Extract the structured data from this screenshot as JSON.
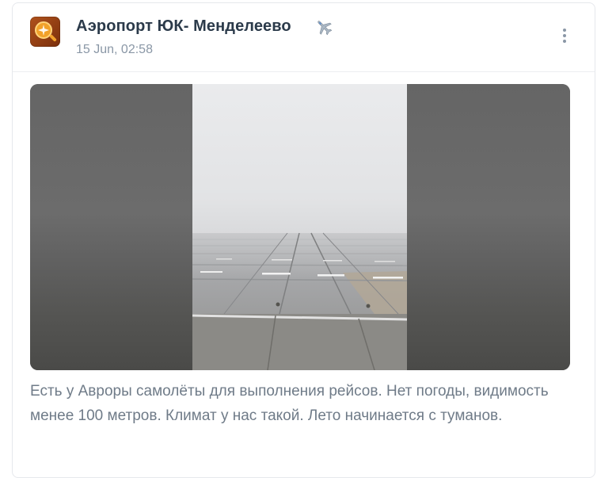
{
  "post": {
    "channel_name": "Аэропорт ЮК- Менделеево",
    "emoji": "airplane-emoji",
    "date": "15 Jun, 02:58",
    "caption": "Есть у Авроры самолёты для выполнения рейсов. Нет погоды, видимость менее 100 метров. Климат у нас такой. Лето начинается с туманов.",
    "media_kind": "video",
    "avatar_icon": "airport-logo-icon",
    "more_icon": "more-vertical-icon"
  },
  "colors": {
    "channel_name": "#2b3a4a",
    "meta_text": "#8a97a6",
    "caption_text": "#6f7b88",
    "avatar_bg": "#a84a18",
    "avatar_accent": "#f1a12a"
  }
}
